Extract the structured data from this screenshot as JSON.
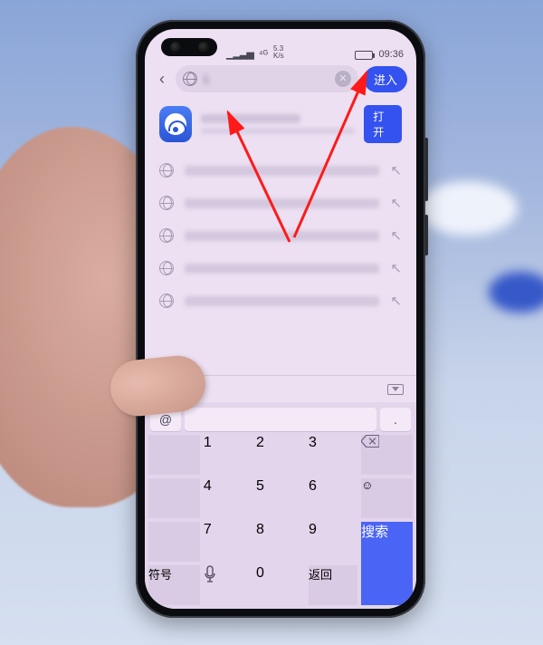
{
  "statusbar": {
    "signal": "⁴ᴳ",
    "speed_top": "5.3",
    "speed_unit": "K/s",
    "time": "09:36"
  },
  "address_bar": {
    "typed_value": "1",
    "enter_label": "进入"
  },
  "featured": {
    "open_label": "打开"
  },
  "suggestions": [
    {
      "prefix": "1"
    },
    {
      "prefix": "1"
    },
    {
      "prefix": "1"
    },
    {
      "prefix": "1"
    },
    {
      "prefix": "1"
    }
  ],
  "keyboard": {
    "accent_at": "@",
    "accent_dot": ".",
    "rows": {
      "r1": [
        "1",
        "2",
        "3"
      ],
      "r2": [
        "4",
        "5",
        "6"
      ],
      "r3": [
        "7",
        "8",
        "9"
      ]
    },
    "bottom": {
      "symbols": "符号",
      "zero": "0",
      "return": "返回",
      "search": "搜索"
    }
  },
  "colors": {
    "accent_blue": "#3452f0",
    "screen_bg": "#ede0f2"
  }
}
